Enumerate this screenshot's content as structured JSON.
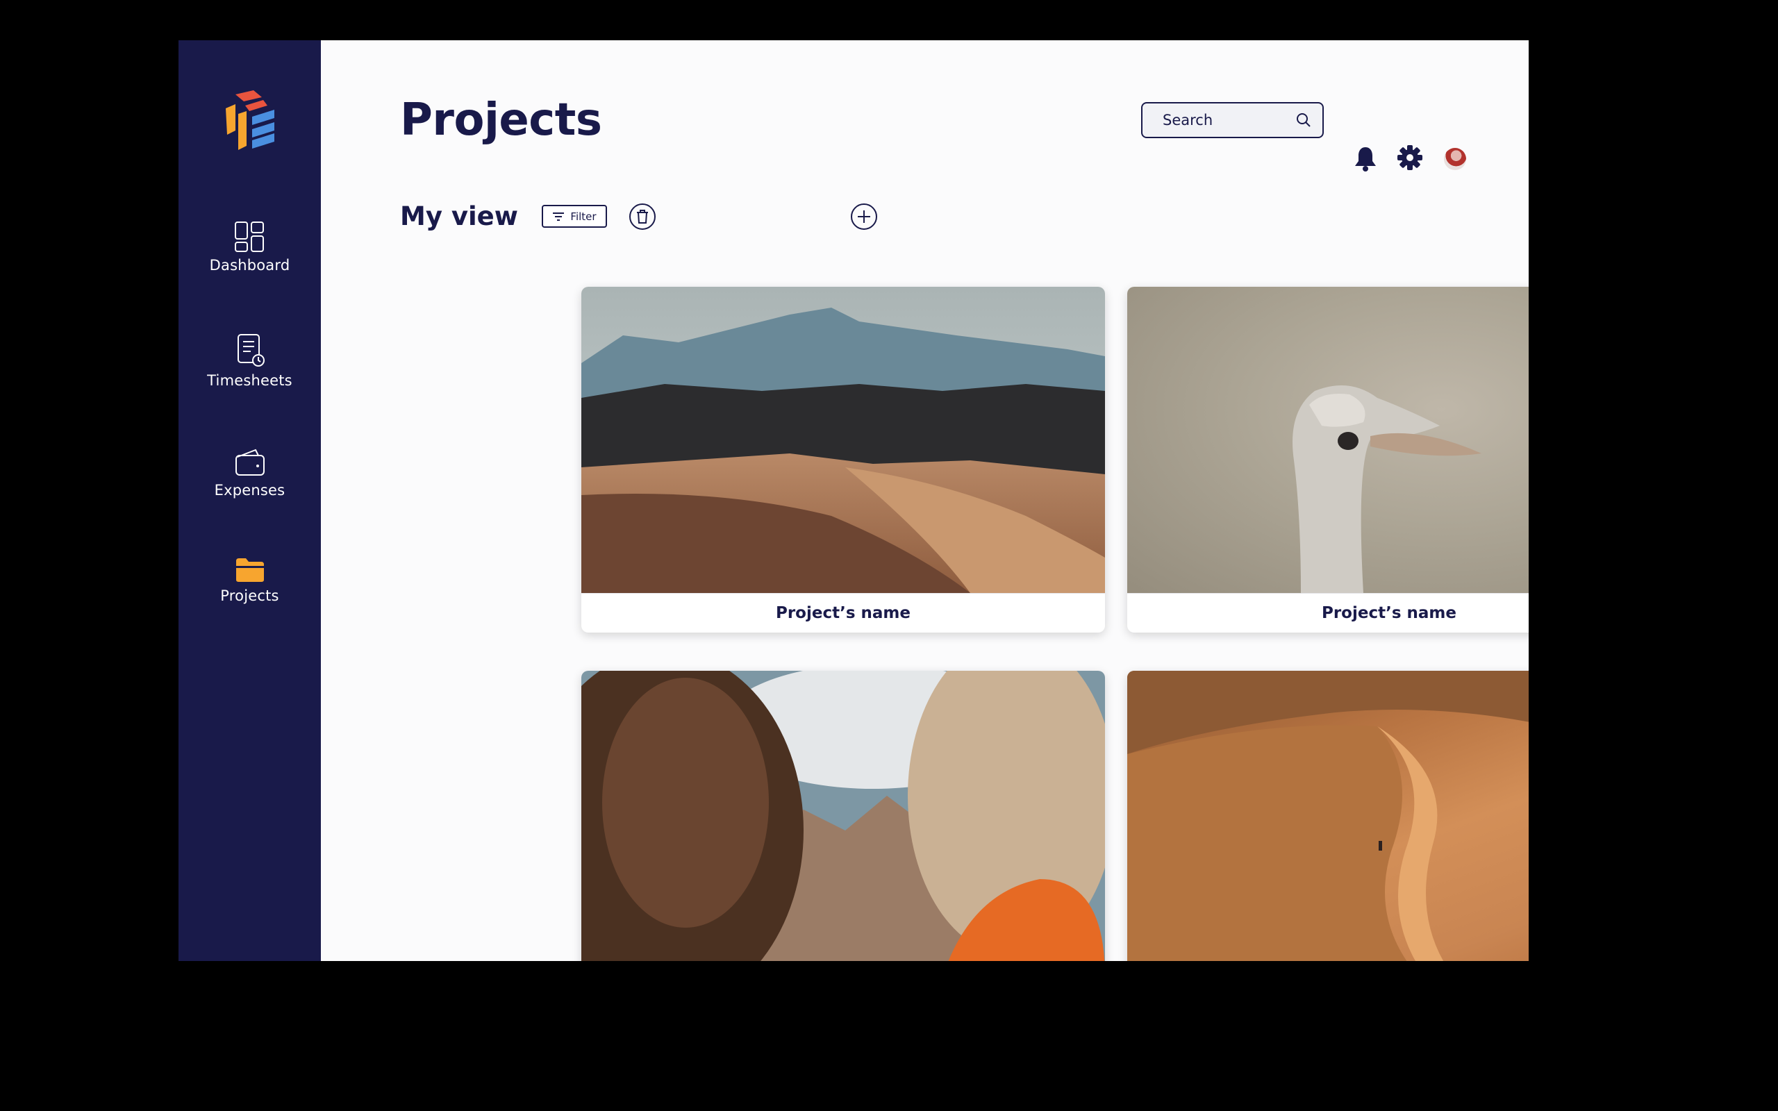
{
  "sidebar": {
    "items": [
      {
        "label": "Dashboard",
        "icon": "dashboard-icon"
      },
      {
        "label": "Timesheets",
        "icon": "timesheet-icon"
      },
      {
        "label": "Expenses",
        "icon": "wallet-icon"
      },
      {
        "label": "Projects",
        "icon": "folder-icon",
        "active": true
      }
    ],
    "colors": {
      "background": "#191a4a",
      "active_icon": "#f7a52f"
    }
  },
  "header": {
    "title": "Projects",
    "search": {
      "placeholder": "Search",
      "value": ""
    },
    "icons": [
      "bell-icon",
      "gear-icon",
      "avatar"
    ]
  },
  "view": {
    "title": "My view",
    "filter_label": "Filter",
    "actions": [
      "trash-icon",
      "plus-icon"
    ]
  },
  "cards": [
    {
      "name": "Project’s name",
      "image": "desert-mountains"
    },
    {
      "name": "Project’s name",
      "image": "ostrich"
    },
    {
      "name": "",
      "image": "women-mountains"
    },
    {
      "name": "",
      "image": "desert-dune"
    }
  ],
  "colors": {
    "primary": "#191a4a",
    "accent": "#f7a52f",
    "logo_red": "#e8543e",
    "logo_blue": "#4a8fe0"
  }
}
